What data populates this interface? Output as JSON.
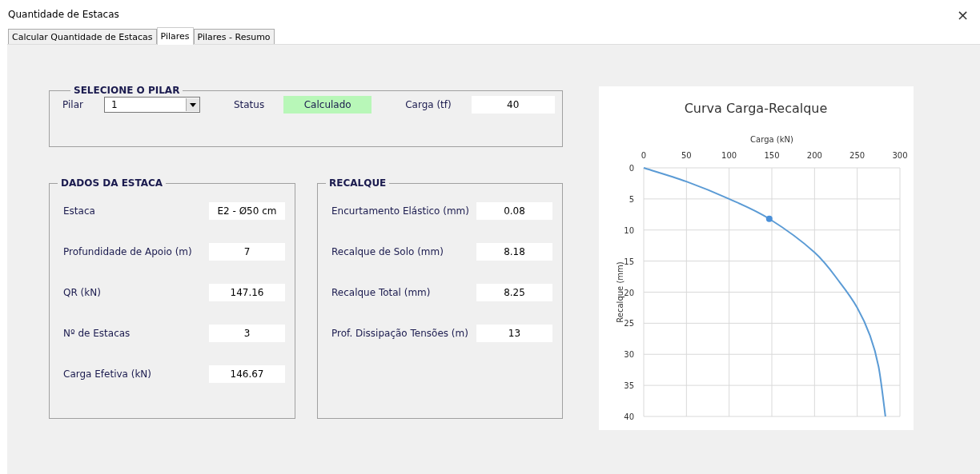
{
  "window": {
    "title": "Quantidade de Estacas",
    "close": "×"
  },
  "tabs": [
    {
      "label": "Calcular Quantidade de Estacas",
      "selected": false
    },
    {
      "label": "Pilares",
      "selected": true
    },
    {
      "label": "Pilares - Resumo",
      "selected": false
    }
  ],
  "selecione": {
    "title": "SELECIONE O PILAR",
    "pilar_label": "Pilar",
    "pilar_value": "1",
    "status_label": "Status",
    "status_value": "Calculado",
    "carga_label": "Carga (tf)",
    "carga_value": "40"
  },
  "dados_da_estaca": {
    "title": "DADOS DA ESTACA",
    "rows": [
      {
        "label": "Estaca",
        "value": "E2 - Ø50 cm"
      },
      {
        "label": "Profundidade de Apoio (m)",
        "value": "7"
      },
      {
        "label": "QR (kN)",
        "value": "147.16"
      },
      {
        "label": "Nº de Estacas",
        "value": "3"
      },
      {
        "label": "Carga Efetiva (kN)",
        "value": "146.67"
      }
    ]
  },
  "recalque": {
    "title": "RECALQUE",
    "rows": [
      {
        "label": "Encurtamento Elástico (mm)",
        "value": "0.08"
      },
      {
        "label": "Recalque de Solo (mm)",
        "value": "8.18"
      },
      {
        "label": "Recalque Total (mm)",
        "value": "8.25"
      },
      {
        "label": "Prof. Dissipação Tensões (m)",
        "value": "13"
      }
    ]
  },
  "chart": {
    "chart_data": {
      "type": "line",
      "title": "Curva Carga-Recalque",
      "xlabel": "Carga (kN)",
      "ylabel": "Recalque (mm)",
      "x": [
        0,
        50,
        100,
        147,
        200,
        230,
        250,
        265,
        275,
        283
      ],
      "series": [
        {
          "color": "#5b9bd5",
          "values": [
            0,
            2.2,
            5,
            8.2,
            13.6,
            18.5,
            22.5,
            27,
            32,
            40
          ]
        },
        {
          "color": "#4a90d9",
          "marker": "circle",
          "values": [
            null,
            null,
            null,
            8.2,
            null,
            null,
            null,
            null,
            null,
            null
          ]
        }
      ],
      "grid": true,
      "xlim": [
        0,
        300
      ],
      "ylim": [
        40,
        0
      ],
      "xticks": [
        0,
        50,
        100,
        150,
        200,
        250,
        300
      ],
      "yticks": [
        0,
        5,
        10,
        15,
        20,
        25,
        30,
        35,
        40
      ]
    }
  }
}
